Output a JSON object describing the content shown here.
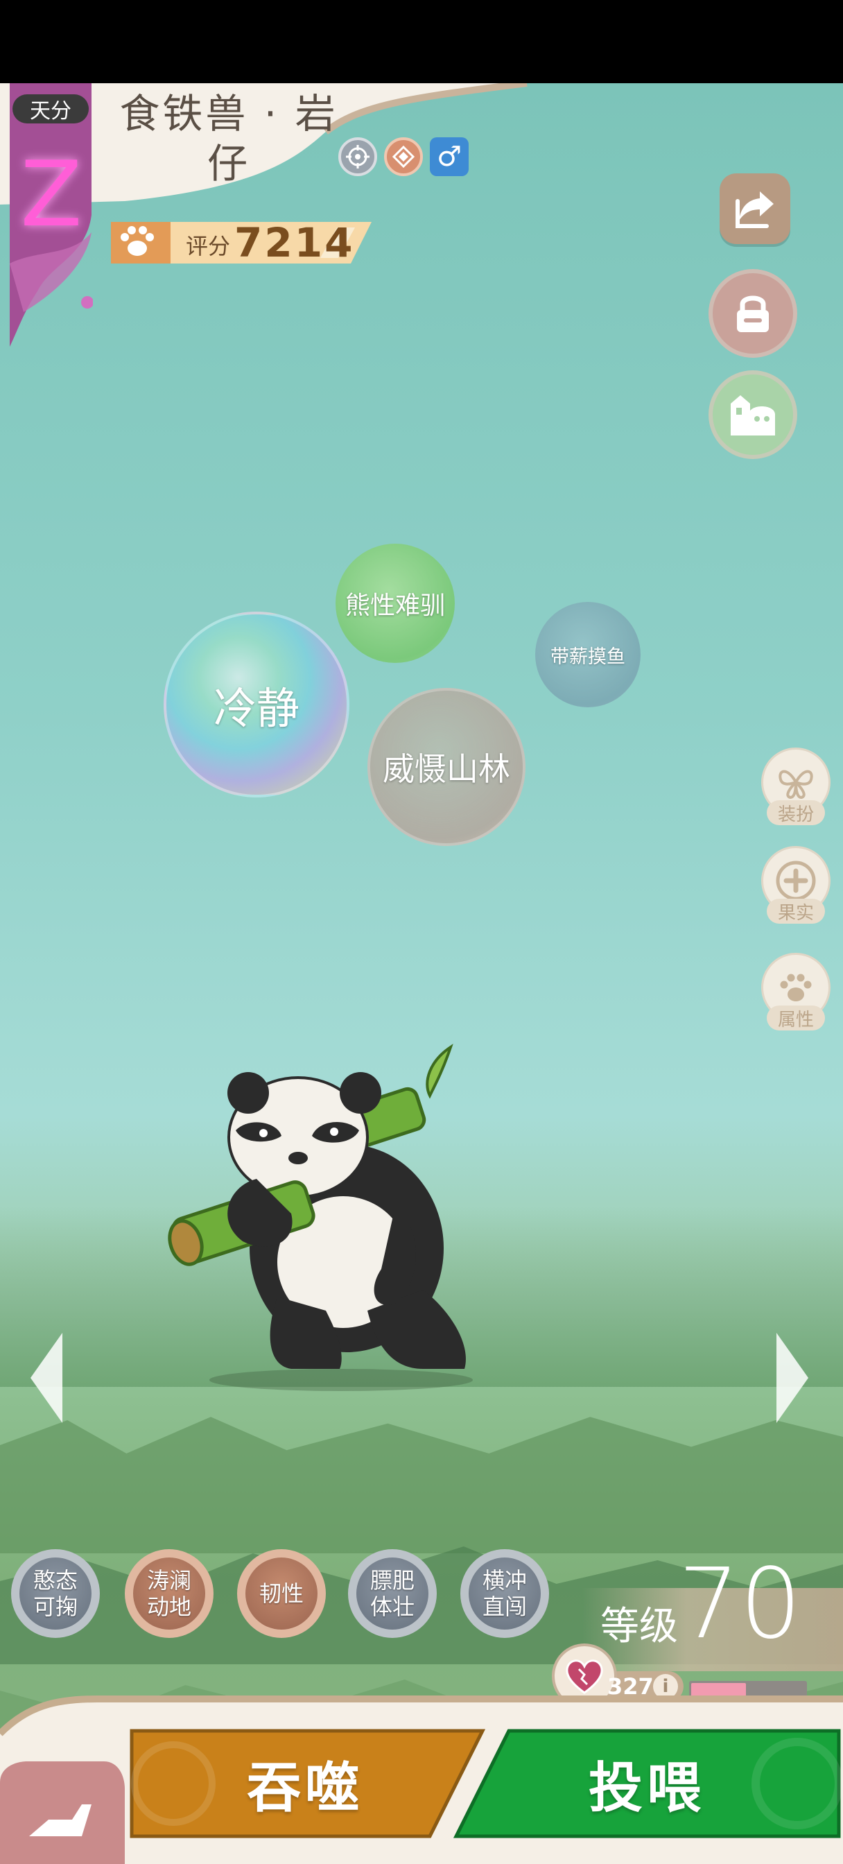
{
  "header": {
    "rank_tag": "天分",
    "rank_letter": "Z",
    "pet_name_line1": "食铁兽 · 岩",
    "pet_name_line2": "仔",
    "type_icons": [
      "target-icon",
      "fire-badge-icon",
      "male-icon"
    ],
    "gender_symbol": "♂"
  },
  "score": {
    "label": "评分",
    "value": "7214"
  },
  "toolbar": {
    "share_icon": "share-icon",
    "lock_icon": "lock-icon",
    "home_icon": "home-icon"
  },
  "side_menu": [
    {
      "label": "装扮",
      "icon": "butterfly-icon"
    },
    {
      "label": "果实",
      "icon": "plus-icon"
    },
    {
      "label": "属性",
      "icon": "paw-icon"
    }
  ],
  "traits": [
    "冷静",
    "熊性难驯",
    "带薪摸鱼",
    "威慑山林"
  ],
  "skills": [
    {
      "line1": "憨态",
      "line2": "可掬",
      "style": "gray"
    },
    {
      "line1": "涛澜",
      "line2": "动地",
      "style": "copper"
    },
    {
      "line1": "韧性",
      "line2": "",
      "style": "copper"
    },
    {
      "line1": "膘肥",
      "line2": "体壮",
      "style": "gray"
    },
    {
      "line1": "横冲",
      "line2": "直闯",
      "style": "gray"
    }
  ],
  "level": {
    "label": "等级",
    "value": "70"
  },
  "affinity": {
    "value": "327",
    "info": "i",
    "progress": 0.48
  },
  "actions": {
    "devour": "吞噬",
    "feed": "投喂"
  },
  "colors": {
    "devour": "#c9811a",
    "feed": "#17a33b",
    "rank": "#ff5ed7",
    "panel": "#f5efe6"
  }
}
